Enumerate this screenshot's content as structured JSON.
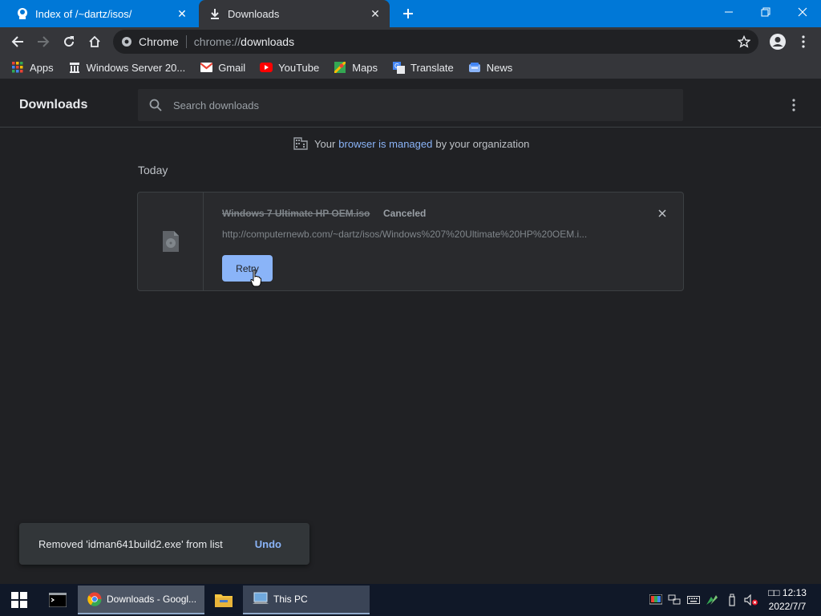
{
  "tabs": [
    {
      "title": "Index of /~dartz/isos/",
      "icon": "site-favicon-icon",
      "active": false
    },
    {
      "title": "Downloads",
      "icon": "download-icon",
      "active": true
    }
  ],
  "toolbar": {
    "omnibox_label": "Chrome",
    "url_scheme": "chrome://",
    "url_host": "downloads"
  },
  "bookmarks": [
    {
      "label": "Apps",
      "icon": "apps-grid-icon"
    },
    {
      "label": "Windows Server 20...",
      "icon": "server-icon"
    },
    {
      "label": "Gmail",
      "icon": "gmail-icon"
    },
    {
      "label": "YouTube",
      "icon": "youtube-icon"
    },
    {
      "label": "Maps",
      "icon": "maps-icon"
    },
    {
      "label": "Translate",
      "icon": "translate-icon"
    },
    {
      "label": "News",
      "icon": "news-icon"
    }
  ],
  "downloads_page": {
    "title": "Downloads",
    "search_placeholder": "Search downloads",
    "managed_prefix": "Your",
    "managed_link": "browser is managed",
    "managed_suffix": "by your organization",
    "section_label": "Today",
    "item": {
      "file_name": "Windows 7 Ultimate HP OEM.iso",
      "status": "Canceled",
      "url": "http://computernewb.com/~dartz/isos/Windows%207%20Ultimate%20HP%20OEM.i...",
      "retry_label": "Retry"
    }
  },
  "toast": {
    "message": "Removed 'idman641build2.exe' from list",
    "undo_label": "Undo"
  },
  "taskbar": {
    "chrome_label": "Downloads - Googl...",
    "thispc_label": "This PC",
    "clock_time": "□□ 12:13",
    "clock_date": "2022/7/7"
  },
  "colors": {
    "titlebar": "#0078d7",
    "accent": "#8ab4f8",
    "background": "#202124",
    "taskbar": "#101828"
  }
}
